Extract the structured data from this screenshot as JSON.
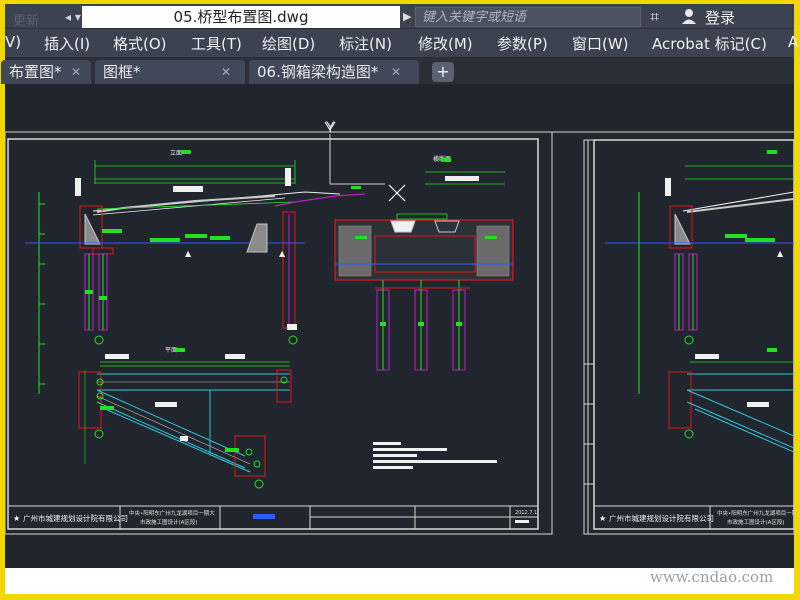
{
  "titlebar": {
    "logo_text": "更新",
    "file_title": "05.桥型布置图.dwg",
    "search_placeholder": "键入关键字或短语",
    "login_label": "登录"
  },
  "menu": {
    "items": [
      "V)",
      "插入(I)",
      "格式(O)",
      "工具(T)",
      "绘图(D)",
      "标注(N)",
      "修改(M)",
      "参数(P)",
      "窗口(W)",
      "Acrobat 标记(C)",
      "A"
    ]
  },
  "tabs": [
    {
      "label": "布置图*"
    },
    {
      "label": "图框*"
    },
    {
      "label": "06.钢箱梁构造图*"
    }
  ],
  "tab_close_glyph": "✕",
  "tab_add_glyph": "+",
  "drawing": {
    "ucs_label": "Y",
    "company_left": "广州市城建规划设计院有限公司",
    "company_right": "广州市城建规划设计院有限公司",
    "project_line1": "中央•阳明东广州九龙湖项目一期大",
    "project_line2": "市政施工图设计(A区段)",
    "date_text": "2012.7.1",
    "section_title_elev": "立面",
    "section_title_plan": "平面",
    "section_title_cross": "横断面"
  },
  "watermark": "www.cndao.com",
  "colors": {
    "background_accent": "#f2d600",
    "canvas": "#21252d",
    "lines_green": "#22e022",
    "lines_red": "#e01818",
    "lines_magenta": "#c020c8",
    "lines_white": "#f0f0f0",
    "lines_blue": "#2a5cff"
  }
}
